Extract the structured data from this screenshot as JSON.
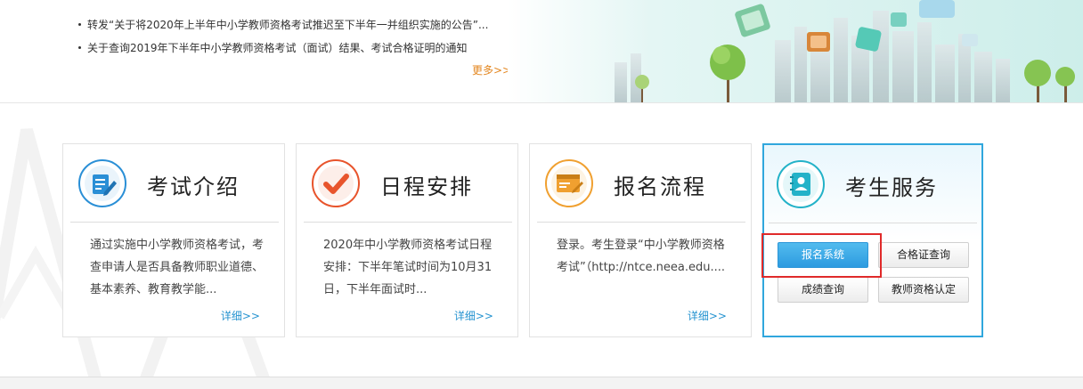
{
  "news": {
    "items": [
      "转发“关于将2020年上半年中小学教师资格考试推迟至下半年一并组织实施的公告”...",
      "关于查询2019年下半年中小学教师资格考试（面试）结果、考试合格证明的通知"
    ],
    "more_label": "更多>>"
  },
  "cards": [
    {
      "title": "考试介绍",
      "desc": "通过实施中小学教师资格考试，考查申请人是否具备教师职业道德、基本素养、教育教学能...",
      "more": "详细>>",
      "icon": "document-edit-icon",
      "accent": "#2a8fd6"
    },
    {
      "title": "日程安排",
      "desc": "2020年中小学教师资格考试日程安排：下半年笔试时间为10月31日，下半年面试时...",
      "more": "详细>>",
      "icon": "checkmark-icon",
      "accent": "#e8542c"
    },
    {
      "title": "报名流程",
      "desc": "登录。考生登录“中小学教师资格考试”（http://ntce.neea.edu....",
      "more": "详细>>",
      "icon": "id-card-icon",
      "accent": "#f0a030"
    }
  ],
  "service": {
    "title": "考生服务",
    "icon": "contact-book-icon",
    "accent": "#23b2c8",
    "buttons": {
      "register": "报名系统",
      "certificate": "合格证查询",
      "score": "成绩查询",
      "qualification": "教师资格认定"
    },
    "highlight_color": "#e02a2a"
  }
}
